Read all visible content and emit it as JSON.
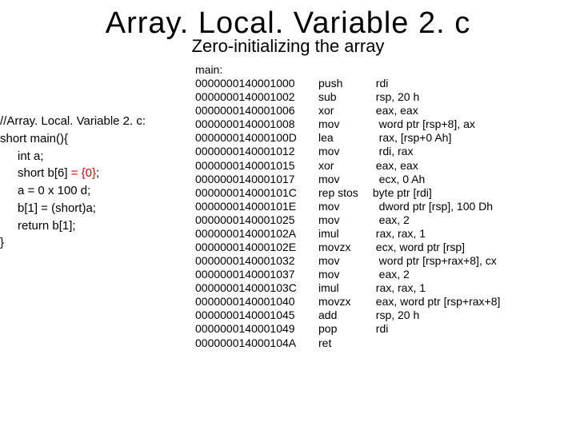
{
  "title": "Array. Local. Variable 2. c",
  "subtitle": "Zero-initializing the array",
  "source": {
    "lines": [
      {
        "text": "//Array. Local. Variable 2. c:",
        "indent": 0
      },
      {
        "text": "short main(){",
        "indent": 0
      },
      {
        "text": "int a;",
        "indent": 1
      },
      {
        "text_pre": "short b[6]",
        "red": " = {0}",
        "text_post": ";",
        "indent": 1
      },
      {
        "text": "a = 0 x 100 d;",
        "indent": 1
      },
      {
        "text": "b[1] = (short)a;",
        "indent": 1
      },
      {
        "text": "return b[1];",
        "indent": 1
      },
      {
        "text": "}",
        "indent": 0
      }
    ]
  },
  "asm": {
    "label": "main:",
    "rows": [
      {
        "addr": "0000000140001000",
        "mnem": "push",
        "ops": "  rdi"
      },
      {
        "addr": "0000000140001002",
        "mnem": "sub",
        "ops": "  rsp, 20 h"
      },
      {
        "addr": "0000000140001006",
        "mnem": "xor",
        "ops": "  eax, eax"
      },
      {
        "addr": "0000000140001008",
        "mnem": "mov",
        "ops": "   word ptr [rsp+8], ax"
      },
      {
        "addr": "000000014000100D",
        "mnem": "lea",
        "ops": "   rax, [rsp+0 Ah]"
      },
      {
        "addr": "0000000140001012",
        "mnem": "mov",
        "ops": "   rdi, rax"
      },
      {
        "addr": "0000000140001015",
        "mnem": "xor",
        "ops": "  eax, eax"
      },
      {
        "addr": "0000000140001017",
        "mnem": "mov",
        "ops": "   ecx, 0 Ah"
      },
      {
        "addr": "000000014000101C",
        "mnem": "rep stos",
        "ops": " byte ptr [rdi]"
      },
      {
        "addr": "000000014000101E",
        "mnem": "mov",
        "ops": "   dword ptr [rsp], 100 Dh"
      },
      {
        "addr": "0000000140001025",
        "mnem": "mov",
        "ops": "   eax, 2"
      },
      {
        "addr": "000000014000102A",
        "mnem": "imul",
        "ops": "  rax, rax, 1"
      },
      {
        "addr": "000000014000102E",
        "mnem": "movzx",
        "ops": "  ecx, word ptr [rsp]"
      },
      {
        "addr": "0000000140001032",
        "mnem": "mov",
        "ops": "   word ptr [rsp+rax+8], cx"
      },
      {
        "addr": "0000000140001037",
        "mnem": "mov",
        "ops": "   eax, 2"
      },
      {
        "addr": "000000014000103C",
        "mnem": "imul",
        "ops": "  rax, rax, 1"
      },
      {
        "addr": "0000000140001040",
        "mnem": "movzx",
        "ops": "  eax, word ptr [rsp+rax+8]"
      },
      {
        "addr": "0000000140001045",
        "mnem": "add",
        "ops": "  rsp, 20 h"
      },
      {
        "addr": "0000000140001049",
        "mnem": "pop",
        "ops": "  rdi"
      },
      {
        "addr": "000000014000104A",
        "mnem": "ret",
        "ops": ""
      }
    ]
  }
}
